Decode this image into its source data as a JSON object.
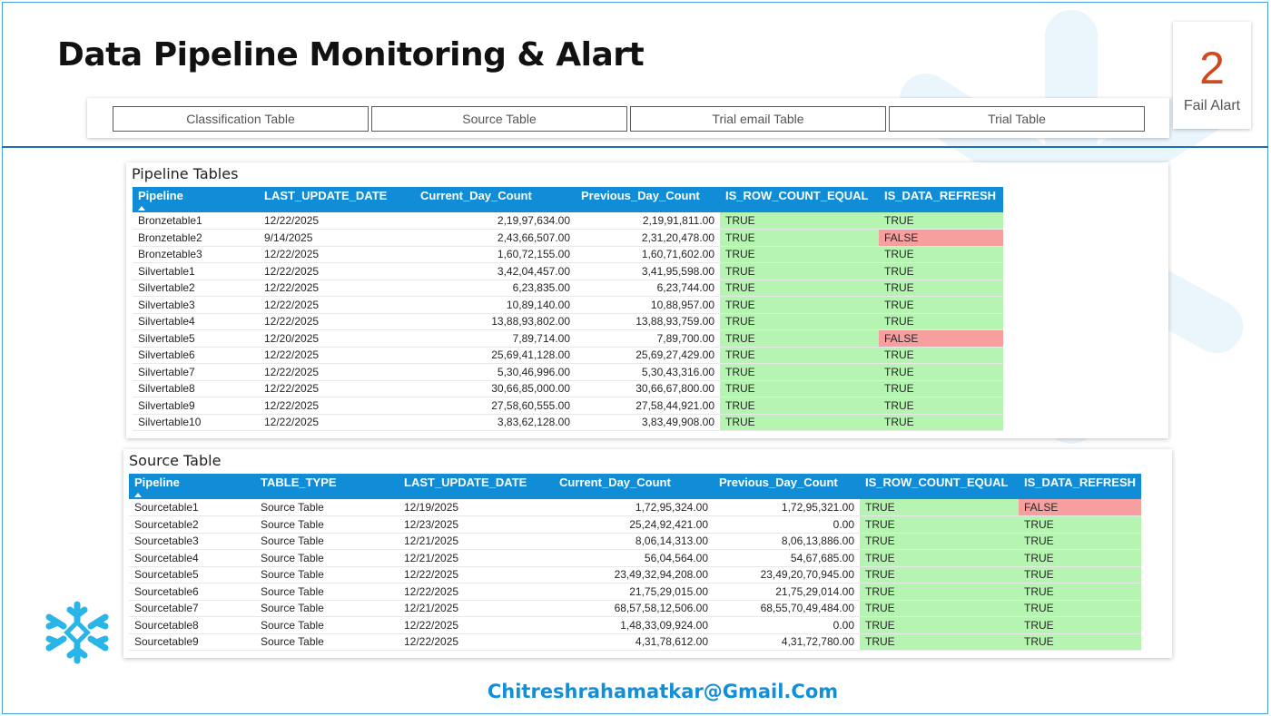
{
  "title": "Data Pipeline Monitoring & Alart",
  "tabs": [
    "Classification Table",
    "Source Table",
    "Trial email Table",
    "Trial Table"
  ],
  "kpi": {
    "value": "2",
    "label": "Fail Alart"
  },
  "colors": {
    "accent": "#118dd8",
    "fail_value": "#d04a1d",
    "true_cell": "#b6f5b1",
    "false_cell": "#f79e9e"
  },
  "pipeline_table": {
    "title": "Pipeline Tables",
    "columns": [
      "Pipeline",
      "LAST_UPDATE_DATE",
      "Current_Day_Count",
      "Previous_Day_Count",
      "IS_ROW_COUNT_EQUAL",
      "IS_DATA_REFRESH"
    ],
    "rows": [
      [
        "Bronzetable1",
        "12/22/2025",
        "2,19,97,634.00",
        "2,19,91,811.00",
        "TRUE",
        "TRUE"
      ],
      [
        "Bronzetable2",
        "9/14/2025",
        "2,43,66,507.00",
        "2,31,20,478.00",
        "TRUE",
        "FALSE"
      ],
      [
        "Bronzetable3",
        "12/22/2025",
        "1,60,72,155.00",
        "1,60,71,602.00",
        "TRUE",
        "TRUE"
      ],
      [
        "Silvertable1",
        "12/22/2025",
        "3,42,04,457.00",
        "3,41,95,598.00",
        "TRUE",
        "TRUE"
      ],
      [
        "Silvertable2",
        "12/22/2025",
        "6,23,835.00",
        "6,23,744.00",
        "TRUE",
        "TRUE"
      ],
      [
        "Silvertable3",
        "12/22/2025",
        "10,89,140.00",
        "10,88,957.00",
        "TRUE",
        "TRUE"
      ],
      [
        "Silvertable4",
        "12/22/2025",
        "13,88,93,802.00",
        "13,88,93,759.00",
        "TRUE",
        "TRUE"
      ],
      [
        "Silvertable5",
        "12/20/2025",
        "7,89,714.00",
        "7,89,700.00",
        "TRUE",
        "FALSE"
      ],
      [
        "Silvertable6",
        "12/22/2025",
        "25,69,41,128.00",
        "25,69,27,429.00",
        "TRUE",
        "TRUE"
      ],
      [
        "Silvertable7",
        "12/22/2025",
        "5,30,46,996.00",
        "5,30,43,316.00",
        "TRUE",
        "TRUE"
      ],
      [
        "Silvertable8",
        "12/22/2025",
        "30,66,85,000.00",
        "30,66,67,800.00",
        "TRUE",
        "TRUE"
      ],
      [
        "Silvertable9",
        "12/22/2025",
        "27,58,60,555.00",
        "27,58,44,921.00",
        "TRUE",
        "TRUE"
      ],
      [
        "Silvertable10",
        "12/22/2025",
        "3,83,62,128.00",
        "3,83,49,908.00",
        "TRUE",
        "TRUE"
      ]
    ]
  },
  "source_table": {
    "title": "Source Table",
    "columns": [
      "Pipeline",
      "TABLE_TYPE",
      "LAST_UPDATE_DATE",
      "Current_Day_Count",
      "Previous_Day_Count",
      "IS_ROW_COUNT_EQUAL",
      "IS_DATA_REFRESH"
    ],
    "rows": [
      [
        "Sourcetable1",
        "Source Table",
        "12/19/2025",
        "1,72,95,324.00",
        "1,72,95,321.00",
        "TRUE",
        "FALSE"
      ],
      [
        "Sourcetable2",
        "Source Table",
        "12/23/2025",
        "25,24,92,421.00",
        "0.00",
        "TRUE",
        "TRUE"
      ],
      [
        "Sourcetable3",
        "Source Table",
        "12/21/2025",
        "8,06,14,313.00",
        "8,06,13,886.00",
        "TRUE",
        "TRUE"
      ],
      [
        "Sourcetable4",
        "Source Table",
        "12/21/2025",
        "56,04,564.00",
        "54,67,685.00",
        "TRUE",
        "TRUE"
      ],
      [
        "Sourcetable5",
        "Source Table",
        "12/22/2025",
        "23,49,32,94,208.00",
        "23,49,20,70,945.00",
        "TRUE",
        "TRUE"
      ],
      [
        "Sourcetable6",
        "Source Table",
        "12/22/2025",
        "21,75,29,015.00",
        "21,75,29,014.00",
        "TRUE",
        "TRUE"
      ],
      [
        "Sourcetable7",
        "Source Table",
        "12/21/2025",
        "68,57,58,12,506.00",
        "68,55,70,49,484.00",
        "TRUE",
        "TRUE"
      ],
      [
        "Sourcetable8",
        "Source Table",
        "12/22/2025",
        "1,48,33,09,924.00",
        "0.00",
        "TRUE",
        "TRUE"
      ],
      [
        "Sourcetable9",
        "Source Table",
        "12/22/2025",
        "4,31,78,612.00",
        "4,31,72,780.00",
        "TRUE",
        "TRUE"
      ]
    ]
  },
  "logo_icon": "snowflake-icon",
  "footer": {
    "email": "Chitreshrahamatkar@Gmail.Com"
  }
}
